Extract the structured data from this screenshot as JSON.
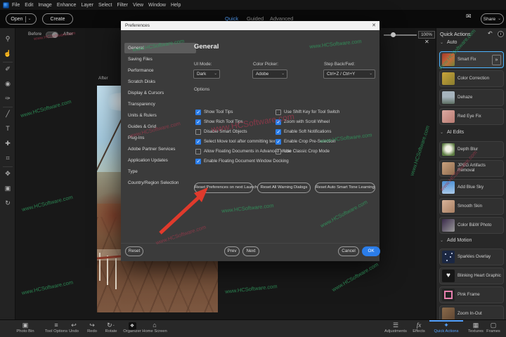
{
  "colors": {
    "accent_blue": "#2b7de9",
    "tab_active": "#55a3ff",
    "quick_actions_active": "#55a3ff",
    "selection_border": "#4db4ff",
    "watermark_green": "#2f9e5f",
    "watermark_red": "#a0384c"
  },
  "watermark": {
    "text": "www.HCSoftware.com"
  },
  "icons": {
    "caret": "⌄",
    "chevron": "⌄",
    "envelope": "✉",
    "close": "✕",
    "undo_arrow": "↶",
    "info": "i",
    "double_chevron": "»"
  },
  "menu_bar": {
    "items": [
      "File",
      "Edit",
      "Image",
      "Enhance",
      "Layer",
      "Select",
      "Filter",
      "View",
      "Window",
      "Help"
    ]
  },
  "header": {
    "open_label": "Open",
    "create_label": "Create",
    "tabs": [
      {
        "label": "Quick",
        "active": true
      },
      {
        "label": "Guided",
        "active": false
      },
      {
        "label": "Advanced",
        "active": false
      }
    ],
    "share_label": "Share"
  },
  "canvas": {
    "before_label": "Before",
    "after_label": "After",
    "photo_tag": "After",
    "zoom_value": "100%"
  },
  "toolbar_tools": [
    {
      "name": "zoom-tool",
      "glyph": "⚲"
    },
    {
      "name": "hand-tool",
      "glyph": "☝"
    },
    {
      "name": "quick-selection-tool",
      "glyph": "✐"
    },
    {
      "name": "red-eye-tool",
      "glyph": "◉"
    },
    {
      "name": "whiten-teeth-tool",
      "glyph": "✑"
    },
    {
      "name": "straighten-tool",
      "glyph": "╱"
    },
    {
      "name": "type-tool",
      "glyph": "T"
    },
    {
      "name": "spot-healing-tool",
      "glyph": "✚"
    },
    {
      "name": "crop-tool",
      "glyph": "⌗"
    },
    {
      "name": "move-tool",
      "glyph": "✥"
    },
    {
      "name": "frame-tool",
      "glyph": "▣"
    },
    {
      "name": "rotate-tool",
      "glyph": "↻"
    }
  ],
  "preferences_dialog": {
    "title": "Preferences",
    "categories": [
      {
        "label": "General",
        "selected": true
      },
      {
        "label": "Saving Files",
        "selected": false
      },
      {
        "label": "Performance",
        "selected": false
      },
      {
        "label": "Scratch Disks",
        "selected": false
      },
      {
        "label": "Display & Cursors",
        "selected": false
      },
      {
        "label": "Transparency",
        "selected": false
      },
      {
        "label": "Units & Rulers",
        "selected": false
      },
      {
        "label": "Guides & Grid",
        "selected": false
      },
      {
        "label": "Plug-Ins",
        "selected": false
      },
      {
        "label": "Adobe Partner Services",
        "selected": false
      },
      {
        "label": "Application Updates",
        "selected": false
      },
      {
        "label": "Type",
        "selected": false
      },
      {
        "label": "Country/Region Selection",
        "selected": false
      }
    ],
    "panel_title": "General",
    "fields": [
      {
        "label": "UI Mode:",
        "value": "Dark"
      },
      {
        "label": "Color Picker:",
        "value": "Adobe"
      },
      {
        "label": "Step Back/Fwd:",
        "value": "Ctrl+Z / Ctrl+Y"
      }
    ],
    "options_label": "Options",
    "options_left": [
      {
        "label": "Show Tool Tips",
        "checked": true
      },
      {
        "label": "Show Rich Tool Tips",
        "checked": true
      },
      {
        "label": "Disable Smart Objects",
        "checked": false
      },
      {
        "label": "Select Move tool after committing text",
        "checked": true
      },
      {
        "label": "Allow Floating Documents in Advanced Mode",
        "checked": false
      },
      {
        "label": "Enable Floating Document Window Docking",
        "checked": true
      }
    ],
    "options_right": [
      {
        "label": "Use Shift Key for Tool Switch",
        "checked": false
      },
      {
        "label": "Zoom with Scroll Wheel",
        "checked": true
      },
      {
        "label": "Enable Soft Notifications",
        "checked": true
      },
      {
        "label": "Enable Crop Pre-Selection",
        "checked": true
      },
      {
        "label": "Use Classic Crop Mode",
        "checked": false
      }
    ],
    "reset_buttons": [
      {
        "label": "Reset Preferences on next Launch"
      },
      {
        "label": "Reset All Warning Dialogs"
      },
      {
        "label": "Reset Auto Smart Tone Learning"
      }
    ],
    "footer": {
      "reset": "Reset",
      "prev": "Prev",
      "next": "Next",
      "cancel": "Cancel",
      "ok": "OK"
    }
  },
  "quick_actions_panel": {
    "title": "Quick Actions",
    "sections": [
      {
        "label": "Auto",
        "items": [
          {
            "label": "Smart Fix",
            "selected": true
          },
          {
            "label": "Color Correction",
            "selected": false
          },
          {
            "label": "Dehaze",
            "selected": false
          },
          {
            "label": "Red Eye Fix",
            "selected": false
          }
        ]
      },
      {
        "label": "AI Edits",
        "items": [
          {
            "label": "Depth Blur",
            "selected": false
          },
          {
            "label": "JPEG Artifacts Removal",
            "selected": false
          },
          {
            "label": "Add Blue Sky",
            "selected": false
          },
          {
            "label": "Smooth Skin",
            "selected": false
          },
          {
            "label": "Color B&W Photo",
            "selected": false
          }
        ]
      },
      {
        "label": "Add Motion",
        "items": [
          {
            "label": "Sparkles Overlay",
            "selected": false
          },
          {
            "label": "Blinking Heart Graphic",
            "selected": false
          },
          {
            "label": "Pink Frame",
            "selected": false
          },
          {
            "label": "Zoom In-Out",
            "selected": false
          }
        ]
      }
    ]
  },
  "taskbar": {
    "left": [
      {
        "label": "Photo Bin",
        "glyph": "▣"
      },
      {
        "label": "Tool Options",
        "glyph": "≡"
      },
      {
        "label": "Undo",
        "glyph": "↩"
      },
      {
        "label": "Redo",
        "glyph": "↪"
      },
      {
        "label": "Rotate",
        "glyph": "↻"
      },
      {
        "label": "Organizer",
        "glyph": "❖"
      },
      {
        "label": "Home Screen",
        "glyph": "⌂"
      }
    ],
    "right": [
      {
        "label": "Adjustments",
        "glyph": "☰",
        "active": false
      },
      {
        "label": "Effects",
        "glyph": "fx",
        "active": false
      },
      {
        "label": "Quick Actions",
        "glyph": "✦",
        "active": true
      },
      {
        "label": "Textures",
        "glyph": "▦",
        "active": false
      },
      {
        "label": "Frames",
        "glyph": "▢",
        "active": false
      }
    ]
  }
}
